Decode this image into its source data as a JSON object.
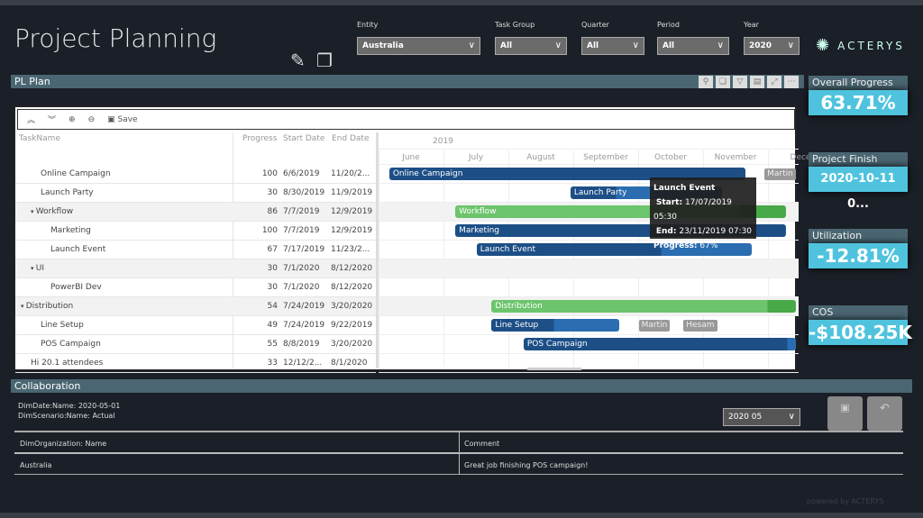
{
  "title": "Project Planning",
  "filters": [
    {
      "label": "Entity",
      "value": "Australia"
    },
    {
      "label": "Task Group",
      "value": "All"
    },
    {
      "label": "Quarter",
      "value": "All"
    },
    {
      "label": "Period",
      "value": "All"
    },
    {
      "label": "Year",
      "value": "2020"
    }
  ],
  "brand": "ACTERYS",
  "plan_header": "PL Plan",
  "toolbar": {
    "save": "Save"
  },
  "columns": [
    "TaskName",
    "Progress",
    "Start Date",
    "End Date"
  ],
  "year": "2019",
  "months": [
    "June",
    "July",
    "August",
    "September",
    "October",
    "November",
    "Dece"
  ],
  "tasks": [
    {
      "name": "Online Campaign",
      "level": 1,
      "progress": 100,
      "start": "6/6/2019",
      "end": "11/20/2...",
      "bar_end": "2019-11-20",
      "bar_start": "2019-06-06"
    },
    {
      "name": "Launch Party",
      "level": 1,
      "progress": 30,
      "start": "8/30/2019",
      "end": "11/9/2019",
      "bar_start": "2019-08-30",
      "bar_end": "2019-11-09"
    },
    {
      "name": "Workflow",
      "level": 1,
      "group": true,
      "progress": 86,
      "start": "7/7/2019",
      "end": "12/9/2019",
      "bar_start": "2019-07-07",
      "bar_end": "2019-12-09"
    },
    {
      "name": "Marketing",
      "level": 2,
      "progress": 100,
      "start": "7/7/2019",
      "end": "12/9/2019",
      "bar_start": "2019-07-07",
      "bar_end": "2019-12-09"
    },
    {
      "name": "Launch Event",
      "level": 2,
      "progress": 67,
      "start": "7/17/2019",
      "end": "11/23/2...",
      "bar_start": "2019-07-17",
      "bar_end": "2019-11-23"
    },
    {
      "name": "UI",
      "level": 1,
      "group": true,
      "progress": 30,
      "start": "7/1/2020",
      "end": "8/12/2020"
    },
    {
      "name": "PowerBI Dev",
      "level": 2,
      "progress": 30,
      "start": "7/1/2020",
      "end": "8/12/2020"
    },
    {
      "name": "Distribution",
      "level": 0,
      "group": true,
      "progress": 54,
      "start": "7/24/2019",
      "end": "3/20/2020",
      "bar_start": "2019-07-24",
      "bar_end": "2020-03-20"
    },
    {
      "name": "Line Setup",
      "level": 1,
      "progress": 49,
      "start": "7/24/2019",
      "end": "9/22/2019",
      "bar_start": "2019-07-24",
      "bar_end": "2019-09-22"
    },
    {
      "name": "POS Campaign",
      "level": 1,
      "progress": 55,
      "start": "8/8/2019",
      "end": "3/20/2020",
      "bar_start": "2019-08-08",
      "bar_end": "2020-03-20"
    },
    {
      "name": "Hi 20.1 attendees",
      "level": 0,
      "progress": 33,
      "start": "12/12/2...",
      "end": "8/1/2020"
    }
  ],
  "resources": [
    {
      "row": 0,
      "name": "Martin",
      "date": "2019-11-29"
    },
    {
      "row": 8,
      "name": "Martin",
      "date": "2019-10-01"
    },
    {
      "row": 8,
      "name": "Hesam",
      "date": "2019-10-22"
    }
  ],
  "tooltip": {
    "title": "Launch Event",
    "start_label": "Start:",
    "start": "17/07/2019 05:30",
    "end_label": "End:",
    "end": "23/11/2019 07:30",
    "progress_label": "Progress:",
    "progress": "67%"
  },
  "kpis": [
    {
      "label": "Overall Progress",
      "value": "63.71%"
    },
    {
      "label": "Project Finish",
      "value": "2020-10-11 0..."
    },
    {
      "label": "Utilization",
      "value": "-12.81%"
    },
    {
      "label": "COS",
      "value": "-$108.25K"
    }
  ],
  "collab": {
    "header": "Collaboration",
    "line1": "DimDate:Name: 2020-05-01",
    "line2": "DimScenario:Name: Actual",
    "period": "2020 05",
    "col1": "DimOrganization: Name",
    "col2": "Comment",
    "row_org": "Australia",
    "row_comment": "Great job finishing POS campaign!"
  },
  "footer": "powered by ACTERYS",
  "colors": {
    "task": "#2a6db0",
    "task_done": "#1d4f86",
    "group": "#6cc46c",
    "group_done": "#48a948",
    "kpi": "#4fc3de",
    "header_bar": "#4a6672"
  }
}
